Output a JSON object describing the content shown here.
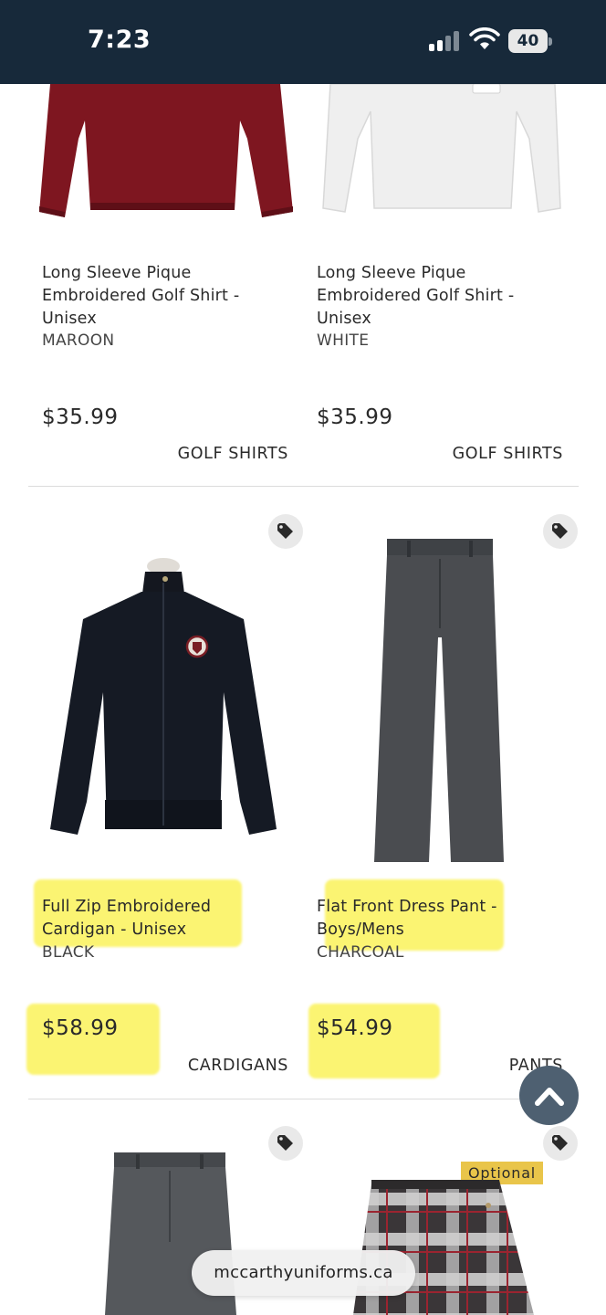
{
  "status_bar": {
    "time": "7:23",
    "battery": "40"
  },
  "products": [
    {
      "title": "Long Sleeve Pique Embroidered Golf Shirt - Unisex",
      "color": "MAROON",
      "price": "$35.99",
      "category": "GOLF SHIRTS"
    },
    {
      "title": "Long Sleeve Pique Embroidered Golf Shirt - Unisex",
      "color": "WHITE",
      "price": "$35.99",
      "category": "GOLF SHIRTS"
    },
    {
      "title": "Full Zip Embroidered Cardigan - Unisex",
      "color": "BLACK",
      "price": "$58.99",
      "category": "CARDIGANS"
    },
    {
      "title": "Flat Front Dress Pant - Boys/Mens",
      "color": "CHARCOAL",
      "price": "$54.99",
      "category": "PANTS"
    }
  ],
  "badges": {
    "optional": "Optional"
  },
  "browser": {
    "url": "mccarthyuniforms.ca"
  },
  "icons": {
    "tag": "tag-icon",
    "scroll_top": "chevron-up-icon",
    "signal": "signal-icon",
    "wifi": "wifi-icon",
    "battery": "battery-icon"
  },
  "colors": {
    "status_bar": "#17293a",
    "highlight": "#faf03c",
    "scroll_button": "#4e6071",
    "optional_badge": "#e9c54a"
  }
}
